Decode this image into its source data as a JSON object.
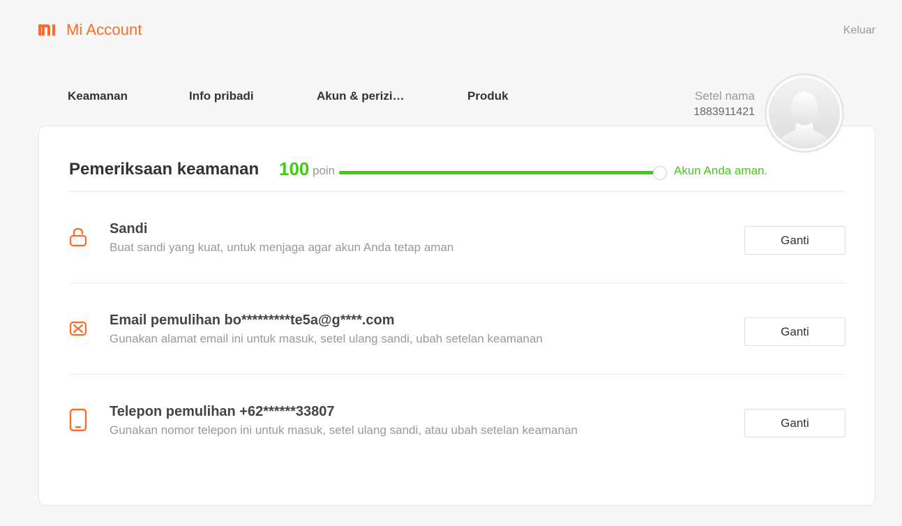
{
  "header": {
    "app_title": "Mi Account",
    "logo_icon": "mi-logo-icon",
    "logout_label": "Keluar"
  },
  "nav": {
    "items": [
      {
        "label": "Keamanan"
      },
      {
        "label": "Info pribadi"
      },
      {
        "label": "Akun & perizi…"
      },
      {
        "label": "Produk"
      }
    ]
  },
  "user": {
    "name": "Setel nama",
    "id": "1883911421",
    "avatar_icon": "default-avatar-icon"
  },
  "security_check": {
    "title": "Pemeriksaan keamanan",
    "score": "100",
    "score_unit": "poin",
    "score_fraction": 1.0,
    "status": "Akun Anda aman."
  },
  "items": [
    {
      "icon": "lock-icon",
      "title": "Sandi",
      "description": "Buat sandi yang kuat, untuk menjaga agar akun Anda tetap aman",
      "button_label": "Ganti"
    },
    {
      "icon": "envelope-icon",
      "title": "Email pemulihan bo*********te5a@g****.com",
      "description": "Gunakan alamat email ini untuk masuk, setel ulang sandi, ubah setelan keamanan",
      "button_label": "Ganti"
    },
    {
      "icon": "phone-icon",
      "title": "Telepon pemulihan +62******33807",
      "description": "Gunakan nomor telepon ini untuk masuk, setel ulang sandi, atau ubah setelan keamanan",
      "button_label": "Ganti"
    }
  ],
  "colors": {
    "brand": "#ff6a26",
    "success": "#3fcc12"
  }
}
